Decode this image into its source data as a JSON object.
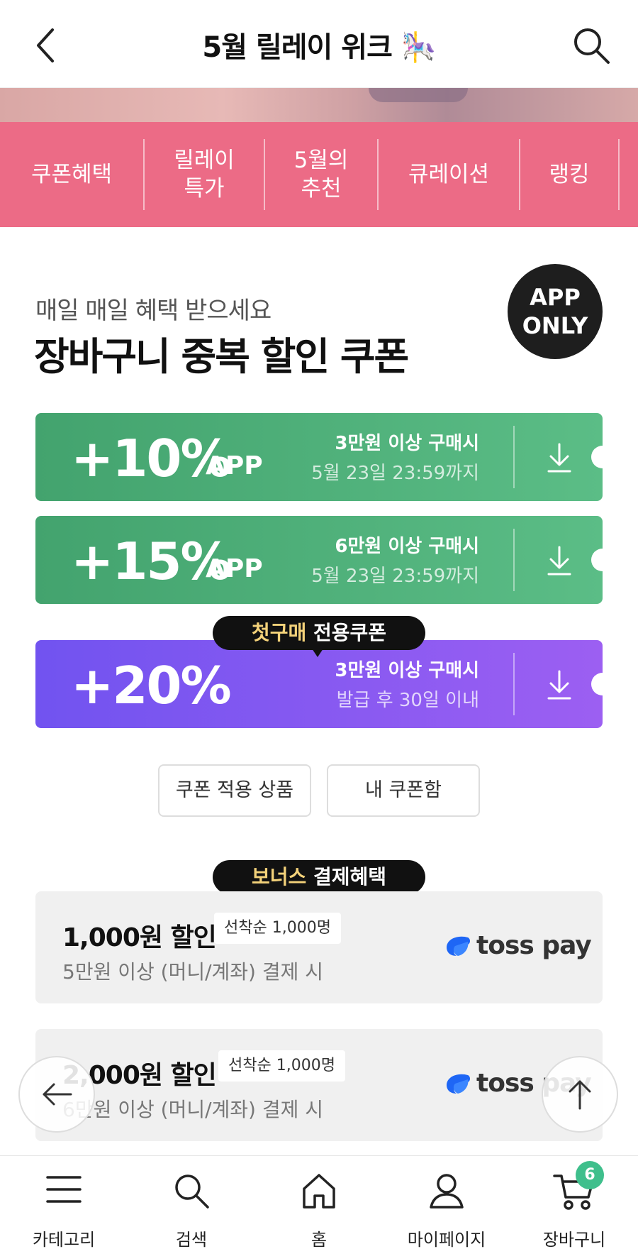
{
  "header": {
    "title": "5월 릴레이 위크 🎠"
  },
  "tabs": [
    {
      "label": "쿠폰혜택"
    },
    {
      "label": "릴레이\n특가"
    },
    {
      "label": "5월의\n추천"
    },
    {
      "label": "큐레이션"
    },
    {
      "label": "랭킹"
    }
  ],
  "section": {
    "subtitle": "매일 매일 혜택 받으세요",
    "title": "장바구니 중복 할인 쿠폰",
    "app_badge": "APP\nONLY"
  },
  "coupons": [
    {
      "percent": "+10%",
      "tag": "APP",
      "condition": "3만원 이상 구매시",
      "validity": "5월 23일 23:59까지"
    },
    {
      "percent": "+15%",
      "tag": "APP",
      "condition": "6만원 이상 구매시",
      "validity": "5월 23일 23:59까지"
    },
    {
      "percent": "+20%",
      "tag": "",
      "condition": "3만원 이상 구매시",
      "validity": "발급 후 30일 이내"
    }
  ],
  "first_purchase_pill": {
    "highlight": "첫구매",
    "text": " 전용쿠폰"
  },
  "buttons": {
    "applicable_products": "쿠폰 적용 상품",
    "my_coupons": "내 쿠폰함"
  },
  "bonus_pill": {
    "highlight": "보너스",
    "text": " 결제혜택"
  },
  "bonus_cards": [
    {
      "amount": "1,000원 할인",
      "limit": "선착순 1,000명",
      "desc": "5만원 이상 (머니/계좌) 결제 시",
      "brand": "toss pay"
    },
    {
      "amount": "2,000원 할인",
      "limit": "선착순 1,000명",
      "desc": "6만원 이상 (머니/계좌) 결제 시",
      "brand": "toss pay"
    }
  ],
  "bottom_nav": [
    {
      "label": "카테고리"
    },
    {
      "label": "검색"
    },
    {
      "label": "홈"
    },
    {
      "label": "마이페이지"
    },
    {
      "label": "장바구니"
    }
  ],
  "cart_badge": "6",
  "colors": {
    "tab_bg": "#ec6b86",
    "coupon_green": "#4fb07a",
    "coupon_purple": "#8459f1",
    "badge_green": "#3fbf8c",
    "toss_blue": "#1e66f5"
  }
}
